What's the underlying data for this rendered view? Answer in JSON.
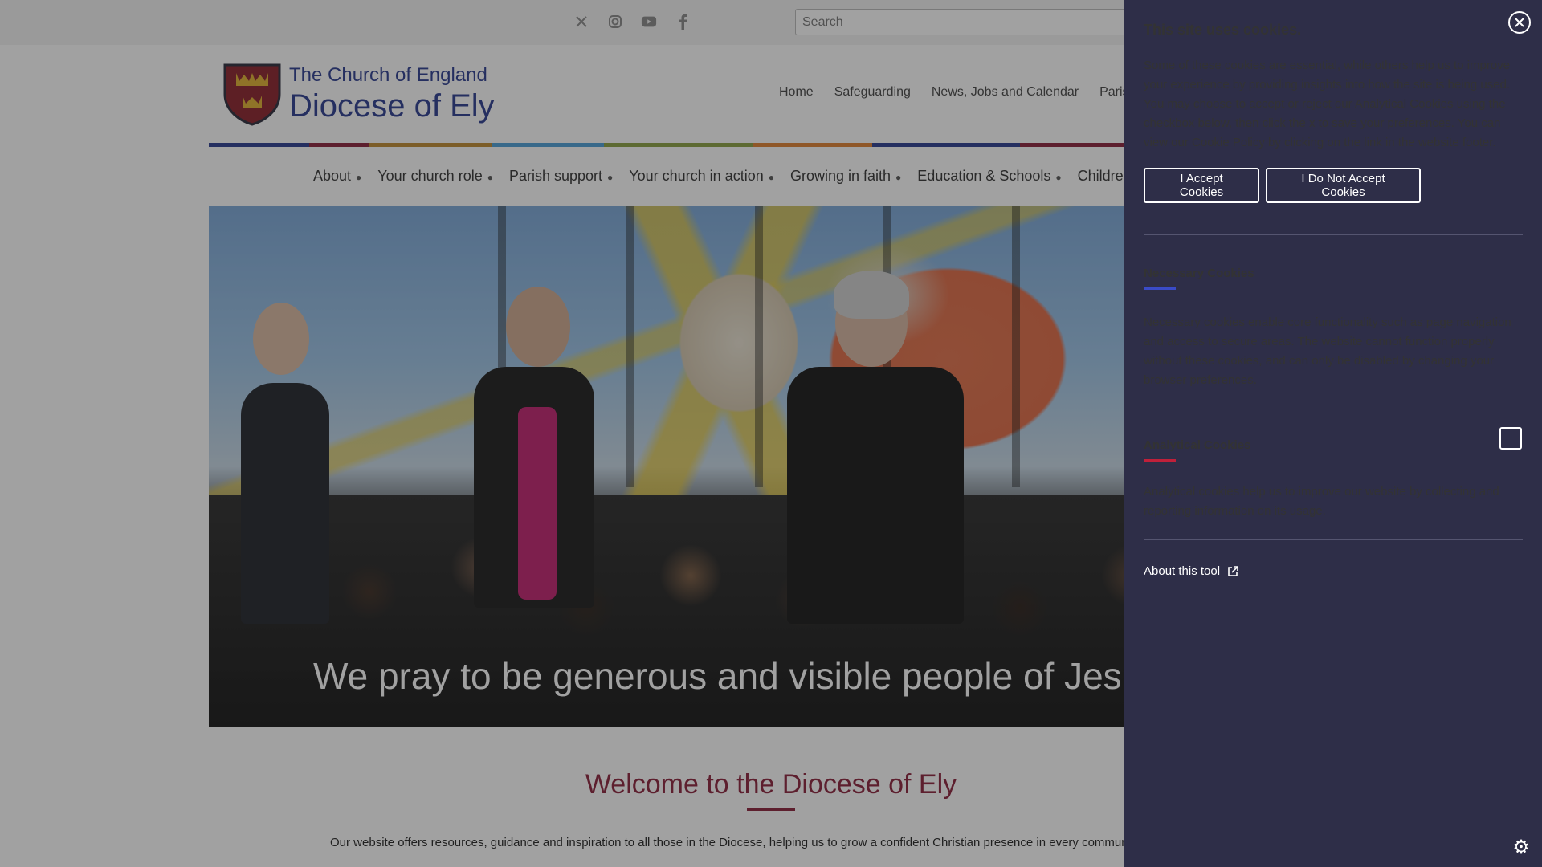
{
  "search": {
    "placeholder": "Search"
  },
  "social": [
    "x-icon",
    "instagram-icon",
    "youtube-icon",
    "facebook-icon"
  ],
  "logo": {
    "line1": "The Church of England",
    "line2": "Diocese of Ely"
  },
  "topnav": [
    "Home",
    "Safeguarding",
    "News, Jobs and Calendar",
    "Parish Su"
  ],
  "mainnav": [
    "About",
    "Your church role",
    "Parish support",
    "Your church in action",
    "Growing in faith",
    "Education & Schools",
    "Children & Youth"
  ],
  "hero": {
    "caption": "We pray to be generous and visible people of Jesus"
  },
  "welcome": {
    "title": "Welcome to the Diocese of Ely",
    "intro": "Our website offers resources, guidance and inspiration to all those in the Diocese, helping us to grow a confident Christian presence in every commun"
  },
  "cookie": {
    "title": "This site uses cookies.",
    "intro": "Some of these cookies are essential, while others help us to improve your experience by providing insights into how the site is being used. You may choose to accept or reject our Analytical Cookies using the checkbox below, then click the x to save your preferences. You can view our Cookie Policy by clicking on the link in the website footer.",
    "accept_label": "I Accept Cookies",
    "reject_label": "I Do Not Accept Cookies",
    "necessary": {
      "title": "Necessary Cookies",
      "text": "Necessary cookies enable core functionality such as page navigation and access to secure areas. The website cannot function properly without these cookies, and can only be disabled by changing your browser preferences."
    },
    "analytical": {
      "title": "Analytical Cookies",
      "text": "Analytical cookies help us to improve our website by collecting and reporting information on its usage."
    },
    "about_label": "About this tool"
  },
  "colors": {
    "panel_bg": "#2e2e48",
    "brand": "#2a3b8f",
    "welcome": "#8a1f3a",
    "necessary_rule": "#3a4bc8",
    "analytical_rule": "#c0203a"
  }
}
